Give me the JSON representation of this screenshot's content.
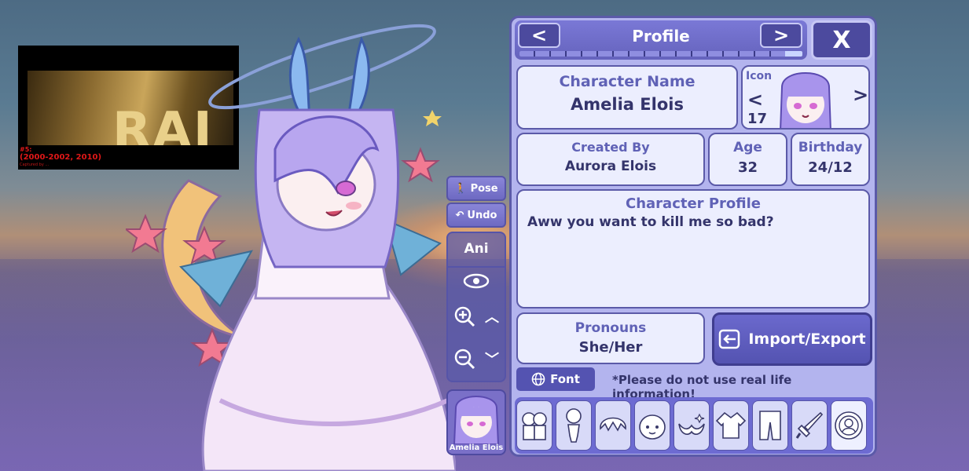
{
  "video_overlay": {
    "letters": "RAI",
    "caption_line1": "#5:",
    "caption_line2": "(2000-2002, 2010)",
    "caption_line3": "Captured by ..."
  },
  "side_controls": {
    "pose_label": "Pose",
    "undo_label": "Undo",
    "ani_label": "Ani",
    "thumbnail_name": "Amelia Elois"
  },
  "profile": {
    "title": "Profile",
    "prev_label": "<",
    "next_label": ">",
    "close_label": "X",
    "progress": 0.95,
    "character_name_label": "Character Name",
    "character_name": "Amelia Elois",
    "icon_label": "Icon",
    "icon_number": "17",
    "icon_prev": "<",
    "icon_next": ">",
    "created_by_label": "Created By",
    "created_by": "Aurora Elois",
    "age_label": "Age",
    "age": "32",
    "birthday_label": "Birthday",
    "birthday": "24/12",
    "character_profile_label": "Character Profile",
    "character_profile_text": "Aww you want to kill me so bad?",
    "pronouns_label": "Pronouns",
    "pronouns": "She/Her",
    "import_export_label": "Import/Export",
    "font_label": "Font",
    "warning": "*Please do not use real life information!"
  },
  "tabs": [
    {
      "icon": "characters-icon"
    },
    {
      "icon": "body-icon"
    },
    {
      "icon": "hair-icon"
    },
    {
      "icon": "face-icon"
    },
    {
      "icon": "accessory-icon"
    },
    {
      "icon": "top-clothing-icon"
    },
    {
      "icon": "bottom-clothing-icon"
    },
    {
      "icon": "weapon-icon"
    },
    {
      "icon": "profile-badge-icon"
    }
  ],
  "colors": {
    "panel_bg": "#b3b4ee",
    "panel_border": "#5b5aa8",
    "label_color": "#6062b6",
    "value_color": "#34346b",
    "button_dark": "#4c4a9e"
  }
}
